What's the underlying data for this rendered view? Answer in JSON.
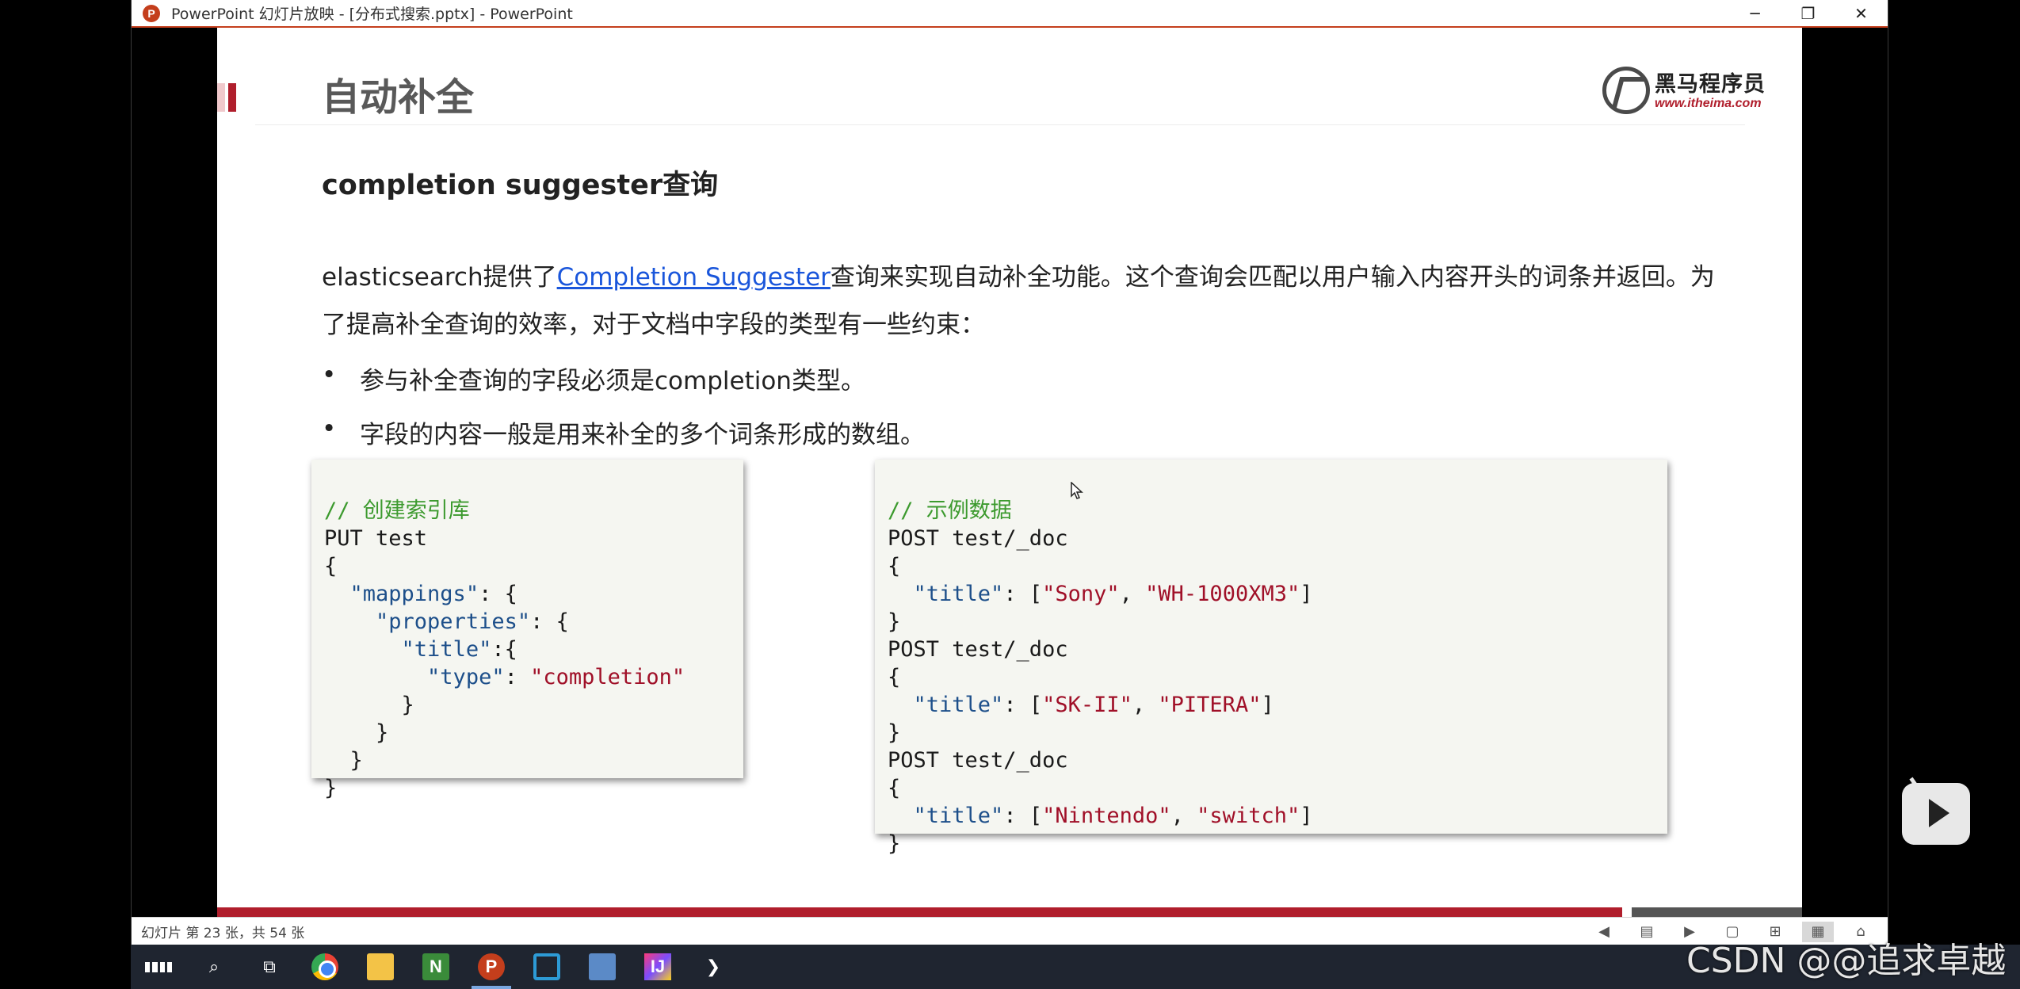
{
  "window": {
    "title": "PowerPoint 幻灯片放映 - [分布式搜索.pptx] - PowerPoint",
    "app_icon": "P",
    "minimize": "─",
    "restore": "❐",
    "close": "✕"
  },
  "slide": {
    "title": "自动补全",
    "logo_cn": "黑马程序员",
    "logo_url": "www.itheima.com",
    "subheading": "completion suggester查询",
    "para_before_link": "elasticsearch提供了",
    "para_link": "Completion Suggester",
    "para_after_link": "查询来实现自动补全功能。这个查询会匹配以用户输入内容开头的词条并返回。为了提高补全查询的效率，对于文档中字段的类型有一些约束：",
    "bullet_char": "•",
    "bullets": [
      "参与补全查询的字段必须是completion类型。",
      "字段的内容一般是用来补全的多个词条形成的数组。"
    ],
    "code_left": {
      "comment": "// 创建索引库",
      "l1": "PUT test",
      "l2": "{",
      "l3_key": "\"mappings\"",
      "l3_rest": ": {",
      "l4_key": "\"properties\"",
      "l4_rest": ": {",
      "l5_key": "\"title\"",
      "l5_rest": ":{",
      "l6_key": "\"type\"",
      "l6_mid": ": ",
      "l6_val": "\"completion\"",
      "l7": "}",
      "l8": "}",
      "l9": "}",
      "l10": "}"
    },
    "code_right": {
      "comment": "// 示例数据",
      "post": "POST test/_doc",
      "open": "{",
      "close": "}",
      "title_key": "\"title\"",
      "d1_a": "\"Sony\"",
      "d1_b": "\"WH-1000XM3\"",
      "d2_a": "\"SK-II\"",
      "d2_b": "\"PITERA\"",
      "d3_a": "\"Nintendo\"",
      "d3_b": "\"switch\""
    }
  },
  "statusbar": {
    "slide_count": "幻灯片 第 23 张，共 54 张",
    "views": [
      "◀",
      "▤",
      "▶",
      "▢",
      "⊞",
      "▦",
      "⌂"
    ]
  },
  "taskbar": {
    "items": [
      "start-icon",
      "search-icon",
      "task-view-icon",
      "chrome-icon",
      "file-explorer-icon",
      "notepad-plus-plus-icon",
      "powerpoint-icon",
      "virtualbox-icon",
      "remote-desktop-icon",
      "intellij-idea-icon",
      "vscode-icon"
    ],
    "search_glyph": "⌕",
    "taskview_glyph": "⧉",
    "nb_text": "N",
    "ppt_text": "P",
    "idea_text": "IJ",
    "vsc_glyph": "❯"
  },
  "watermark": "CSDN @@追求卓越",
  "colors": {
    "accent_red": "#b01e2c",
    "link_blue": "#1a56db",
    "code_comment": "#3c9a2e",
    "code_key": "#1d4f8a",
    "code_string": "#a01028"
  }
}
